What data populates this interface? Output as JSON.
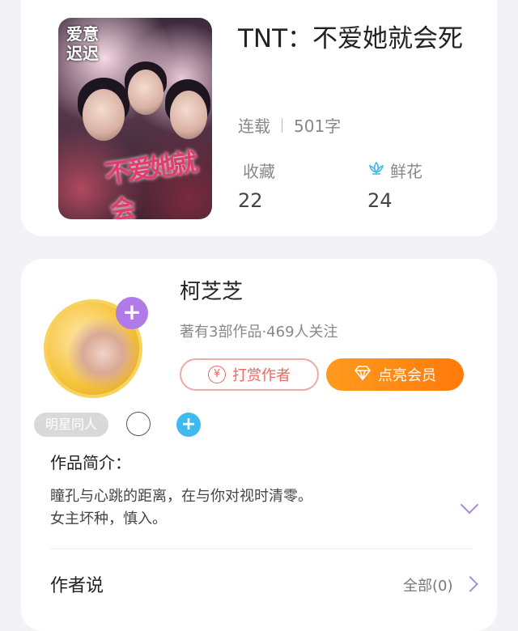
{
  "book": {
    "cover_text_corner": "爱意\n迟迟",
    "cover_text_main": "不爱她就会",
    "title": "TNT：不爱她就会死",
    "status": "连载",
    "word_count": "501字",
    "favorites_label": "收藏",
    "favorites_value": "22",
    "flowers_label": "鲜花",
    "flowers_value": "24"
  },
  "author": {
    "name": "柯芝芝",
    "subtitle": "著有3部作品·469人关注",
    "reward_button": "打赏作者",
    "reward_icon_glyph": "¥",
    "vip_button": "点亮会员",
    "follow_plus": "+",
    "tag": "明星同人",
    "add_plus": "+",
    "intro_heading": "作品简介：",
    "intro_line1": "瞳孔与心跳的距离，在与你对视时清零。",
    "intro_line2": "女主坏种，慎入。",
    "author_says_heading": "作者说",
    "author_says_all": "全部(0)"
  },
  "colors": {
    "accent_purple": "#b07ae8",
    "vip_orange": "#ff8c14",
    "reward_red": "#e9695e",
    "add_blue": "#3fb9ee"
  }
}
